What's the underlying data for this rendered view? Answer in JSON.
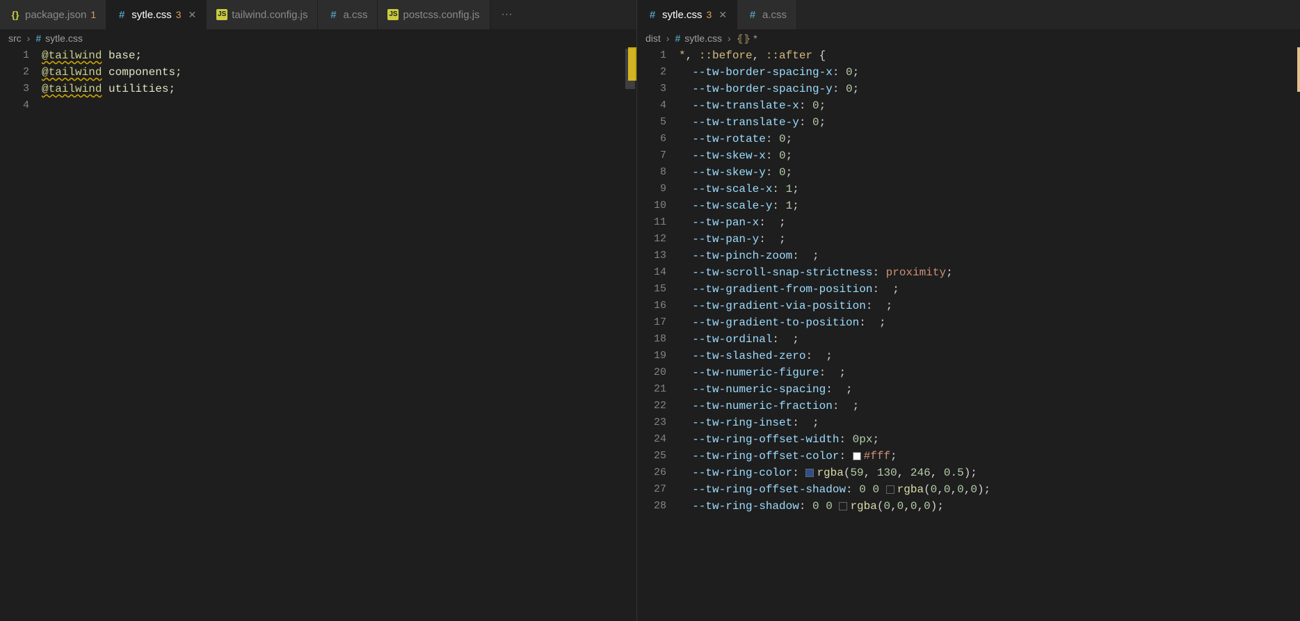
{
  "leftPane": {
    "tabs": [
      {
        "icon": "json",
        "label": "package.json",
        "badge": "1",
        "active": false,
        "close": false
      },
      {
        "icon": "css",
        "label": "sytle.css",
        "badge": "3",
        "active": true,
        "close": true
      },
      {
        "icon": "js",
        "label": "tailwind.config.js",
        "badge": "",
        "active": false,
        "close": false
      },
      {
        "icon": "css",
        "label": "a.css",
        "badge": "",
        "active": false,
        "close": false
      },
      {
        "icon": "js",
        "label": "postcss.config.js",
        "badge": "",
        "active": false,
        "close": false
      }
    ],
    "overflow": "···",
    "breadcrumb": {
      "root": "src",
      "sep": "›",
      "file": "sytle.css"
    },
    "code": [
      {
        "n": "1",
        "tokens": [
          {
            "t": "@tailwind",
            "c": "c-keydir squiggly"
          },
          {
            "t": " base;",
            "c": "c-ident"
          }
        ]
      },
      {
        "n": "2",
        "tokens": [
          {
            "t": "@tailwind",
            "c": "c-keydir squiggly"
          },
          {
            "t": " components;",
            "c": "c-ident"
          }
        ]
      },
      {
        "n": "3",
        "tokens": [
          {
            "t": "@tailwind",
            "c": "c-keydir squiggly"
          },
          {
            "t": " utilities;",
            "c": "c-ident"
          }
        ]
      },
      {
        "n": "4",
        "tokens": []
      }
    ]
  },
  "rightPane": {
    "tabs": [
      {
        "icon": "css",
        "label": "sytle.css",
        "badge": "3",
        "active": true,
        "close": true
      },
      {
        "icon": "css",
        "label": "a.css",
        "badge": "",
        "active": false,
        "close": false
      }
    ],
    "breadcrumb": {
      "root": "dist",
      "sep": "›",
      "file": "sytle.css",
      "sel": "*"
    },
    "code": [
      {
        "n": "1",
        "tokens": [
          {
            "t": "*",
            "c": "c-sel"
          },
          {
            "t": ", ",
            "c": "c-punc"
          },
          {
            "t": "::before",
            "c": "c-sel"
          },
          {
            "t": ", ",
            "c": "c-punc"
          },
          {
            "t": "::after",
            "c": "c-sel"
          },
          {
            "t": " {",
            "c": "c-punc"
          }
        ]
      },
      {
        "n": "2",
        "tokens": [
          {
            "t": "  ",
            "c": ""
          },
          {
            "t": "--tw-border-spacing-x",
            "c": "c-prop"
          },
          {
            "t": ": ",
            "c": "c-punc"
          },
          {
            "t": "0",
            "c": "c-num"
          },
          {
            "t": ";",
            "c": "c-punc"
          }
        ]
      },
      {
        "n": "3",
        "tokens": [
          {
            "t": "  ",
            "c": ""
          },
          {
            "t": "--tw-border-spacing-y",
            "c": "c-prop"
          },
          {
            "t": ": ",
            "c": "c-punc"
          },
          {
            "t": "0",
            "c": "c-num"
          },
          {
            "t": ";",
            "c": "c-punc"
          }
        ]
      },
      {
        "n": "4",
        "tokens": [
          {
            "t": "  ",
            "c": ""
          },
          {
            "t": "--tw-translate-x",
            "c": "c-prop"
          },
          {
            "t": ": ",
            "c": "c-punc"
          },
          {
            "t": "0",
            "c": "c-num"
          },
          {
            "t": ";",
            "c": "c-punc"
          }
        ]
      },
      {
        "n": "5",
        "tokens": [
          {
            "t": "  ",
            "c": ""
          },
          {
            "t": "--tw-translate-y",
            "c": "c-prop"
          },
          {
            "t": ": ",
            "c": "c-punc"
          },
          {
            "t": "0",
            "c": "c-num"
          },
          {
            "t": ";",
            "c": "c-punc"
          }
        ]
      },
      {
        "n": "6",
        "tokens": [
          {
            "t": "  ",
            "c": ""
          },
          {
            "t": "--tw-rotate",
            "c": "c-prop"
          },
          {
            "t": ": ",
            "c": "c-punc"
          },
          {
            "t": "0",
            "c": "c-num"
          },
          {
            "t": ";",
            "c": "c-punc"
          }
        ]
      },
      {
        "n": "7",
        "tokens": [
          {
            "t": "  ",
            "c": ""
          },
          {
            "t": "--tw-skew-x",
            "c": "c-prop"
          },
          {
            "t": ": ",
            "c": "c-punc"
          },
          {
            "t": "0",
            "c": "c-num"
          },
          {
            "t": ";",
            "c": "c-punc"
          }
        ]
      },
      {
        "n": "8",
        "tokens": [
          {
            "t": "  ",
            "c": ""
          },
          {
            "t": "--tw-skew-y",
            "c": "c-prop"
          },
          {
            "t": ": ",
            "c": "c-punc"
          },
          {
            "t": "0",
            "c": "c-num"
          },
          {
            "t": ";",
            "c": "c-punc"
          }
        ]
      },
      {
        "n": "9",
        "tokens": [
          {
            "t": "  ",
            "c": ""
          },
          {
            "t": "--tw-scale-x",
            "c": "c-prop"
          },
          {
            "t": ": ",
            "c": "c-punc"
          },
          {
            "t": "1",
            "c": "c-num"
          },
          {
            "t": ";",
            "c": "c-punc"
          }
        ]
      },
      {
        "n": "10",
        "tokens": [
          {
            "t": "  ",
            "c": ""
          },
          {
            "t": "--tw-scale-y",
            "c": "c-prop"
          },
          {
            "t": ": ",
            "c": "c-punc"
          },
          {
            "t": "1",
            "c": "c-num"
          },
          {
            "t": ";",
            "c": "c-punc"
          }
        ]
      },
      {
        "n": "11",
        "tokens": [
          {
            "t": "  ",
            "c": ""
          },
          {
            "t": "--tw-pan-x",
            "c": "c-prop"
          },
          {
            "t": ":  ;",
            "c": "c-punc"
          }
        ]
      },
      {
        "n": "12",
        "tokens": [
          {
            "t": "  ",
            "c": ""
          },
          {
            "t": "--tw-pan-y",
            "c": "c-prop"
          },
          {
            "t": ":  ;",
            "c": "c-punc"
          }
        ]
      },
      {
        "n": "13",
        "tokens": [
          {
            "t": "  ",
            "c": ""
          },
          {
            "t": "--tw-pinch-zoom",
            "c": "c-prop"
          },
          {
            "t": ":  ;",
            "c": "c-punc"
          }
        ]
      },
      {
        "n": "14",
        "tokens": [
          {
            "t": "  ",
            "c": ""
          },
          {
            "t": "--tw-scroll-snap-strictness",
            "c": "c-prop"
          },
          {
            "t": ": ",
            "c": "c-punc"
          },
          {
            "t": "proximity",
            "c": "c-val"
          },
          {
            "t": ";",
            "c": "c-punc"
          }
        ]
      },
      {
        "n": "15",
        "tokens": [
          {
            "t": "  ",
            "c": ""
          },
          {
            "t": "--tw-gradient-from-position",
            "c": "c-prop"
          },
          {
            "t": ":  ;",
            "c": "c-punc"
          }
        ]
      },
      {
        "n": "16",
        "tokens": [
          {
            "t": "  ",
            "c": ""
          },
          {
            "t": "--tw-gradient-via-position",
            "c": "c-prop"
          },
          {
            "t": ":  ;",
            "c": "c-punc"
          }
        ]
      },
      {
        "n": "17",
        "tokens": [
          {
            "t": "  ",
            "c": ""
          },
          {
            "t": "--tw-gradient-to-position",
            "c": "c-prop"
          },
          {
            "t": ":  ;",
            "c": "c-punc"
          }
        ]
      },
      {
        "n": "18",
        "tokens": [
          {
            "t": "  ",
            "c": ""
          },
          {
            "t": "--tw-ordinal",
            "c": "c-prop"
          },
          {
            "t": ":  ;",
            "c": "c-punc"
          }
        ]
      },
      {
        "n": "19",
        "tokens": [
          {
            "t": "  ",
            "c": ""
          },
          {
            "t": "--tw-slashed-zero",
            "c": "c-prop"
          },
          {
            "t": ":  ;",
            "c": "c-punc"
          }
        ]
      },
      {
        "n": "20",
        "tokens": [
          {
            "t": "  ",
            "c": ""
          },
          {
            "t": "--tw-numeric-figure",
            "c": "c-prop"
          },
          {
            "t": ":  ;",
            "c": "c-punc"
          }
        ]
      },
      {
        "n": "21",
        "tokens": [
          {
            "t": "  ",
            "c": ""
          },
          {
            "t": "--tw-numeric-spacing",
            "c": "c-prop"
          },
          {
            "t": ":  ;",
            "c": "c-punc"
          }
        ]
      },
      {
        "n": "22",
        "tokens": [
          {
            "t": "  ",
            "c": ""
          },
          {
            "t": "--tw-numeric-fraction",
            "c": "c-prop"
          },
          {
            "t": ":  ;",
            "c": "c-punc"
          }
        ]
      },
      {
        "n": "23",
        "tokens": [
          {
            "t": "  ",
            "c": ""
          },
          {
            "t": "--tw-ring-inset",
            "c": "c-prop"
          },
          {
            "t": ":  ;",
            "c": "c-punc"
          }
        ]
      },
      {
        "n": "24",
        "tokens": [
          {
            "t": "  ",
            "c": ""
          },
          {
            "t": "--tw-ring-offset-width",
            "c": "c-prop"
          },
          {
            "t": ": ",
            "c": "c-punc"
          },
          {
            "t": "0px",
            "c": "c-num"
          },
          {
            "t": ";",
            "c": "c-punc"
          }
        ]
      },
      {
        "n": "25",
        "tokens": [
          {
            "t": "  ",
            "c": ""
          },
          {
            "t": "--tw-ring-offset-color",
            "c": "c-prop"
          },
          {
            "t": ": ",
            "c": "c-punc"
          },
          {
            "swatch": "swatch-white"
          },
          {
            "t": "#fff",
            "c": "c-val"
          },
          {
            "t": ";",
            "c": "c-punc"
          }
        ]
      },
      {
        "n": "26",
        "tokens": [
          {
            "t": "  ",
            "c": ""
          },
          {
            "t": "--tw-ring-color",
            "c": "c-prop"
          },
          {
            "t": ": ",
            "c": "c-punc"
          },
          {
            "swatch": "swatch-blue"
          },
          {
            "t": "rgba",
            "c": "c-func"
          },
          {
            "t": "(",
            "c": "c-punc"
          },
          {
            "t": "59",
            "c": "c-num"
          },
          {
            "t": ", ",
            "c": "c-punc"
          },
          {
            "t": "130",
            "c": "c-num"
          },
          {
            "t": ", ",
            "c": "c-punc"
          },
          {
            "t": "246",
            "c": "c-num"
          },
          {
            "t": ", ",
            "c": "c-punc"
          },
          {
            "t": "0.5",
            "c": "c-num"
          },
          {
            "t": ");",
            "c": "c-punc"
          }
        ]
      },
      {
        "n": "27",
        "tokens": [
          {
            "t": "  ",
            "c": ""
          },
          {
            "t": "--tw-ring-offset-shadow",
            "c": "c-prop"
          },
          {
            "t": ": ",
            "c": "c-punc"
          },
          {
            "t": "0 0 ",
            "c": "c-num"
          },
          {
            "swatch": "swatch-trans"
          },
          {
            "t": "rgba",
            "c": "c-func"
          },
          {
            "t": "(",
            "c": "c-punc"
          },
          {
            "t": "0",
            "c": "c-num"
          },
          {
            "t": ",",
            "c": "c-punc"
          },
          {
            "t": "0",
            "c": "c-num"
          },
          {
            "t": ",",
            "c": "c-punc"
          },
          {
            "t": "0",
            "c": "c-num"
          },
          {
            "t": ",",
            "c": "c-punc"
          },
          {
            "t": "0",
            "c": "c-num"
          },
          {
            "t": ");",
            "c": "c-punc"
          }
        ]
      },
      {
        "n": "28",
        "tokens": [
          {
            "t": "  ",
            "c": ""
          },
          {
            "t": "--tw-ring-shadow",
            "c": "c-prop"
          },
          {
            "t": ": ",
            "c": "c-punc"
          },
          {
            "t": "0 0 ",
            "c": "c-num"
          },
          {
            "swatch": "swatch-trans"
          },
          {
            "t": "rgba",
            "c": "c-func"
          },
          {
            "t": "(",
            "c": "c-punc"
          },
          {
            "t": "0",
            "c": "c-num"
          },
          {
            "t": ",",
            "c": "c-punc"
          },
          {
            "t": "0",
            "c": "c-num"
          },
          {
            "t": ",",
            "c": "c-punc"
          },
          {
            "t": "0",
            "c": "c-num"
          },
          {
            "t": ",",
            "c": "c-punc"
          },
          {
            "t": "0",
            "c": "c-num"
          },
          {
            "t": ");",
            "c": "c-punc"
          }
        ]
      }
    ]
  }
}
